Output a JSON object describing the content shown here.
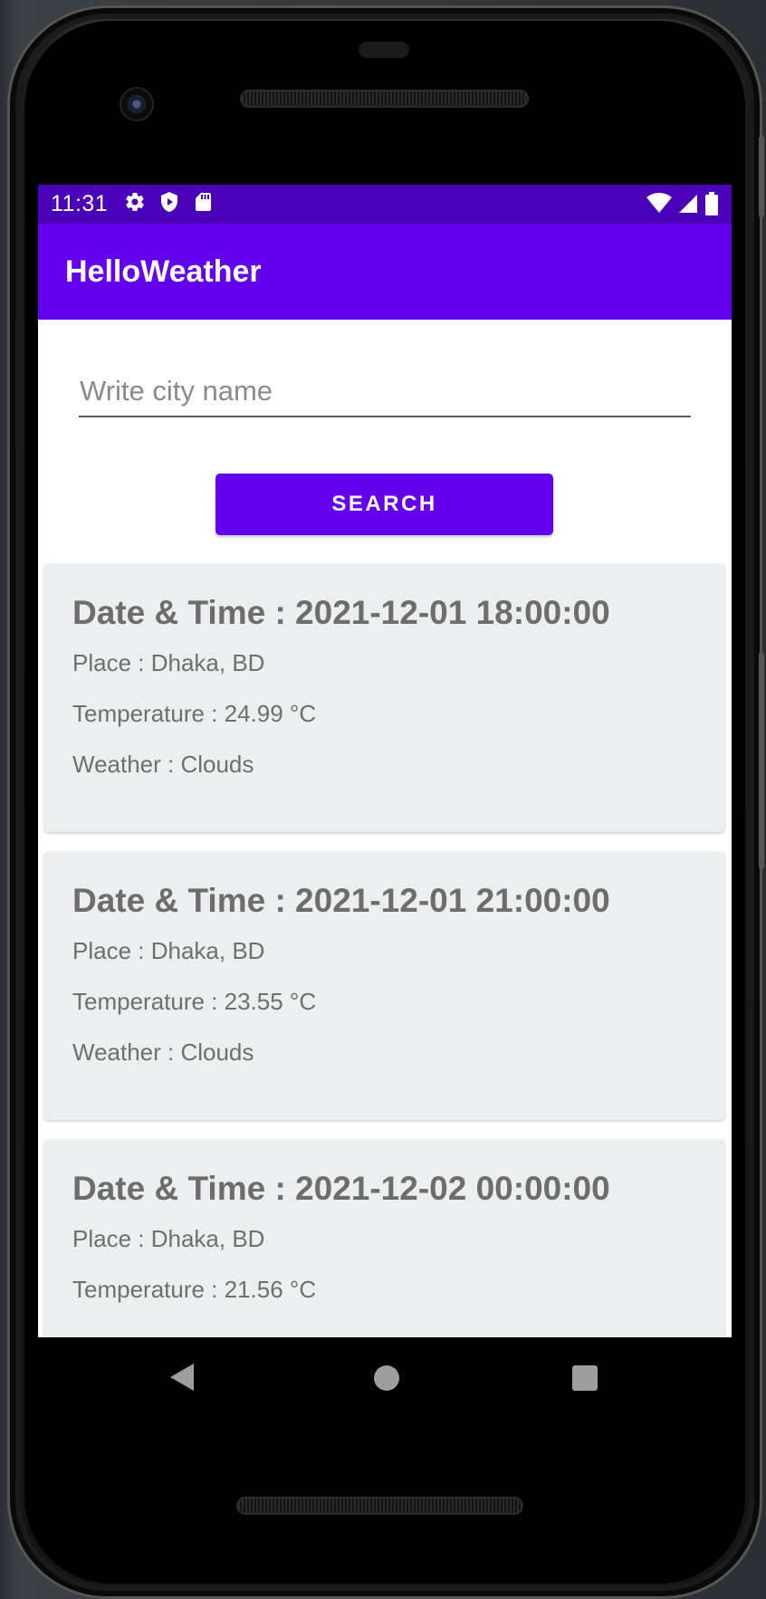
{
  "status_bar": {
    "time": "11:31",
    "left_icons": [
      "gear-icon",
      "shield-play-icon",
      "sd-card-icon"
    ],
    "right_icons": [
      "wifi-icon",
      "signal-icon",
      "battery-icon"
    ]
  },
  "app_bar": {
    "title": "HelloWeather"
  },
  "search": {
    "placeholder": "Write city name",
    "value": "",
    "button_label": "SEARCH"
  },
  "forecast": [
    {
      "title": "Date & Time : 2021-12-01 18:00:00",
      "place": "Place : Dhaka, BD",
      "temperature": "Temperature : 24.99 °C",
      "weather": "Weather : Clouds"
    },
    {
      "title": "Date & Time : 2021-12-01 21:00:00",
      "place": "Place : Dhaka, BD",
      "temperature": "Temperature : 23.55 °C",
      "weather": "Weather : Clouds"
    },
    {
      "title": "Date & Time : 2021-12-02 00:00:00",
      "place": "Place : Dhaka, BD",
      "temperature": "Temperature : 21.56 °C",
      "weather": ""
    }
  ],
  "colors": {
    "primary": "#6200ee",
    "status_bar": "#4a00b8",
    "card_bg": "#eceff0"
  }
}
